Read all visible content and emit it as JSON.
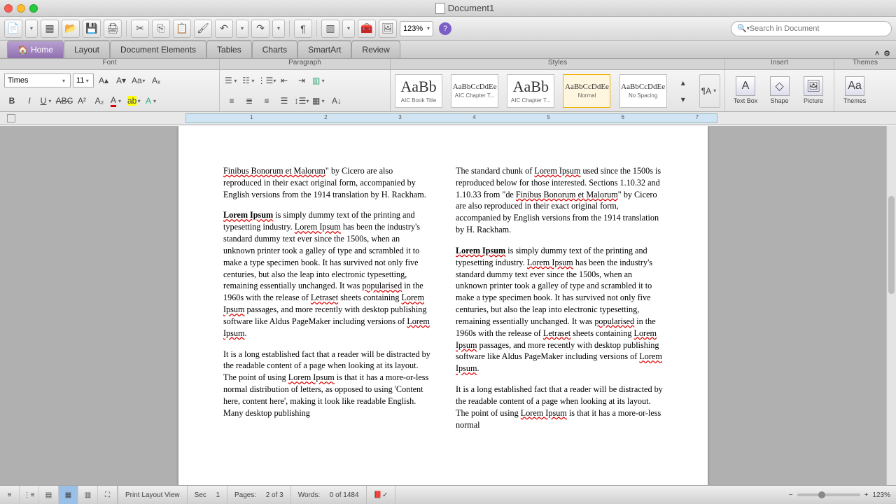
{
  "window": {
    "title": "Document1"
  },
  "toolbar": {
    "zoom": "123%",
    "search_placeholder": "Search in Document"
  },
  "ribbon": {
    "tabs": [
      "Home",
      "Layout",
      "Document Elements",
      "Tables",
      "Charts",
      "SmartArt",
      "Review"
    ],
    "groups": [
      "Font",
      "Paragraph",
      "Styles",
      "Insert",
      "Themes"
    ],
    "font": {
      "name": "Times",
      "size": "11"
    },
    "styles": [
      {
        "preview": "AaBb",
        "label": "AIC Book Title"
      },
      {
        "preview": "AaBbCcDdEe",
        "label": "AIC Chapter T..."
      },
      {
        "preview": "AaBb",
        "label": "AIC Chapter T..."
      },
      {
        "preview": "AaBbCcDdEe",
        "label": "Normal"
      },
      {
        "preview": "AaBbCcDdEe",
        "label": "No Spacing"
      }
    ],
    "insert": [
      "Text Box",
      "Shape",
      "Picture"
    ],
    "themes": "Themes"
  },
  "document": {
    "col1": {
      "p1": {
        "pre": "Finibus Bonorum et Malorum",
        "post": "\" by Cicero are also reproduced in their exact original form, accompanied by English versions from the 1914 translation by H. Rackham."
      },
      "p2": {
        "a": "Lorem Ipsum",
        "b": " is simply dummy text of the printing and typesetting industry. ",
        "c": "Lorem Ipsum",
        "d": " has been the industry's standard dummy text ever since the 1500s, when an unknown printer took a galley of type and scrambled it to make a type specimen book. It has survived not only five centuries, but also the leap into electronic typesetting, remaining essentially unchanged. It was ",
        "e": "popularised",
        "f": " in the 1960s with the release of ",
        "g": "Letraset",
        "h": " sheets containing ",
        "i": "Lorem Ipsum",
        "j": " passages, and more recently with desktop publishing software like Aldus PageMaker including versions of ",
        "k": "Lorem Ipsum",
        "l": "."
      },
      "p3": {
        "a": "It is a long established fact that a reader will be distracted by the readable content of a page when looking at its layout. The point of using ",
        "b": "Lorem Ipsum",
        "c": " is that it has a more-or-less normal distribution of letters, as opposed to using 'Content here, content here', making it look like readable English. Many desktop publishing"
      }
    },
    "col2": {
      "p1": {
        "a": "The standard chunk of ",
        "b": "Lorem Ipsum",
        "c": " used since the 1500s is reproduced below for those interested. Sections 1.10.32 and 1.10.33 from \"de ",
        "d": "Finibus Bonorum et Malorum",
        "e": "\" by Cicero are also reproduced in their exact original form, accompanied by English versions from the 1914 translation by H. Rackham."
      },
      "p2": {
        "a": "Lorem Ipsum",
        "b": " is simply dummy text of the printing and typesetting industry. ",
        "c": "Lorem Ipsum",
        "d": " has been the industry's standard dummy text ever since the 1500s, when an unknown printer took a galley of type and scrambled it to make a type specimen book. It has survived not only five centuries, but also the leap into electronic typesetting, remaining essentially unchanged. It was ",
        "e": "popularised",
        "f": " in the 1960s with the release of ",
        "g": "Letraset",
        "h": " sheets containing ",
        "i": "Lorem Ipsum",
        "j": " passages, and more recently with desktop publishing software like Aldus PageMaker including versions of ",
        "k": "Lorem Ipsum",
        "l": "."
      },
      "p3": {
        "a": "It is a long established fact that a reader will be distracted by the readable content of a page when looking at its layout. The point of using ",
        "b": "Lorem Ipsum",
        "c": " is that it has a more-or-less normal"
      }
    }
  },
  "status": {
    "view_label": "Print Layout View",
    "sec_label": "Sec",
    "sec_val": "1",
    "pages_label": "Pages:",
    "pages_val": "2 of 3",
    "words_label": "Words:",
    "words_val": "0 of 1484",
    "zoom": "123%"
  }
}
